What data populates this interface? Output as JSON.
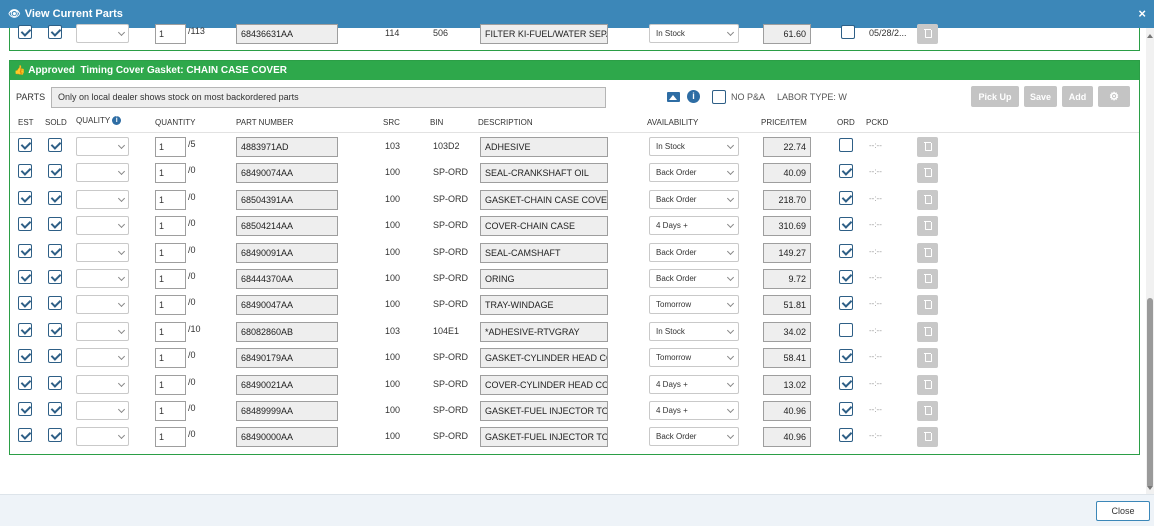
{
  "header": {
    "title": "View Current Parts",
    "close_glyph": "×"
  },
  "top_row": {
    "est": true,
    "sold": true,
    "qty": "1",
    "stock": "/113",
    "part_number": "68436631AA",
    "src": "114",
    "bin": "506",
    "description": "FILTER KI-FUEL/WATER SEPA",
    "availability": "In Stock",
    "price": "61.60",
    "ord": false,
    "pckd": "05/28/2..."
  },
  "section": {
    "status": "Approved",
    "title": "Timing Cover Gasket: CHAIN CASE COVER",
    "parts_label": "PARTS",
    "notes": "Only on local dealer shows stock on most backordered parts",
    "no_pa_label": "NO P&A",
    "labor_type": "LABOR TYPE: W",
    "buttons": {
      "pickup": "Pick Up",
      "save": "Save",
      "add": "Add"
    }
  },
  "columns": {
    "est": "EST",
    "sold": "SOLD",
    "quality": "QUALITY",
    "quantity": "QUANTITY",
    "part_number": "PART NUMBER",
    "src": "SRC",
    "bin": "BIN",
    "description": "DESCRIPTION",
    "availability": "AVAILABILITY",
    "price": "PRICE/ITEM",
    "ord": "ORD",
    "pckd": "PCKD"
  },
  "rows": [
    {
      "qty": "1",
      "stock": "/5",
      "part_number": "4883971AD",
      "src": "103",
      "bin": "103D2",
      "description": "ADHESIVE",
      "availability": "In Stock",
      "price": "22.74",
      "ord": false,
      "pckd": "--:--"
    },
    {
      "qty": "1",
      "stock": "/0",
      "part_number": "68490074AA",
      "src": "100",
      "bin": "SP-ORD",
      "description": "SEAL-CRANKSHAFT OIL",
      "availability": "Back Order",
      "price": "40.09",
      "ord": true,
      "pckd": "--:--"
    },
    {
      "qty": "1",
      "stock": "/0",
      "part_number": "68504391AA",
      "src": "100",
      "bin": "SP-ORD",
      "description": "GASKET-CHAIN CASE COVER",
      "availability": "Back Order",
      "price": "218.70",
      "ord": true,
      "pckd": "--:--"
    },
    {
      "qty": "1",
      "stock": "/0",
      "part_number": "68504214AA",
      "src": "100",
      "bin": "SP-ORD",
      "description": "COVER-CHAIN CASE",
      "availability": "4 Days +",
      "price": "310.69",
      "ord": true,
      "pckd": "--:--"
    },
    {
      "qty": "1",
      "stock": "/0",
      "part_number": "68490091AA",
      "src": "100",
      "bin": "SP-ORD",
      "description": "SEAL-CAMSHAFT",
      "availability": "Back Order",
      "price": "149.27",
      "ord": true,
      "pckd": "--:--"
    },
    {
      "qty": "1",
      "stock": "/0",
      "part_number": "68444370AA",
      "src": "100",
      "bin": "SP-ORD",
      "description": "ORING",
      "availability": "Back Order",
      "price": "9.72",
      "ord": true,
      "pckd": "--:--"
    },
    {
      "qty": "1",
      "stock": "/0",
      "part_number": "68490047AA",
      "src": "100",
      "bin": "SP-ORD",
      "description": "TRAY-WINDAGE",
      "availability": "Tomorrow",
      "price": "51.81",
      "ord": true,
      "pckd": "--:--"
    },
    {
      "qty": "1",
      "stock": "/10",
      "part_number": "68082860AB",
      "src": "103",
      "bin": "104E1",
      "description": "*ADHESIVE-RTVGRAY",
      "availability": "In Stock",
      "price": "34.02",
      "ord": false,
      "pckd": "--:--"
    },
    {
      "qty": "1",
      "stock": "/0",
      "part_number": "68490179AA",
      "src": "100",
      "bin": "SP-ORD",
      "description": "GASKET-CYLINDER HEAD CO\\",
      "availability": "Tomorrow",
      "price": "58.41",
      "ord": true,
      "pckd": "--:--"
    },
    {
      "qty": "1",
      "stock": "/0",
      "part_number": "68490021AA",
      "src": "100",
      "bin": "SP-ORD",
      "description": "COVER-CYLINDER HEAD COV",
      "availability": "4 Days +",
      "price": "13.02",
      "ord": true,
      "pckd": "--:--"
    },
    {
      "qty": "1",
      "stock": "/0",
      "part_number": "68489999AA",
      "src": "100",
      "bin": "SP-ORD",
      "description": "GASKET-FUEL INJECTOR TO \\",
      "availability": "4 Days +",
      "price": "40.96",
      "ord": true,
      "pckd": "--:--"
    },
    {
      "qty": "1",
      "stock": "/0",
      "part_number": "68490000AA",
      "src": "100",
      "bin": "SP-ORD",
      "description": "GASKET-FUEL INJECTOR TO \\",
      "availability": "Back Order",
      "price": "40.96",
      "ord": true,
      "pckd": "--:--"
    }
  ],
  "footer": {
    "close_label": "Close"
  },
  "icons": {
    "header": "eye-icon",
    "section": "thumbs-up-icon",
    "image": "image-icon",
    "info": "info-icon",
    "settings": "gear-icon",
    "delete": "trash-icon"
  },
  "colors": {
    "header": "#3c87b8",
    "section": "#2ea84b",
    "checkbox": "#2e5f86"
  }
}
